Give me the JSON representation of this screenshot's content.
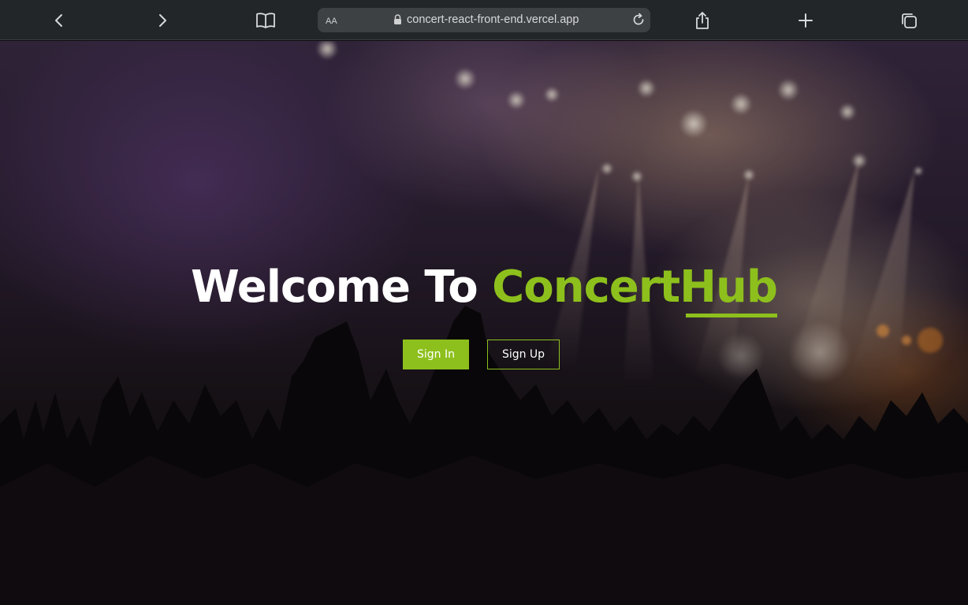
{
  "browser": {
    "reader_label": "AA",
    "url": "concert-react-front-end.vercel.app",
    "icons": [
      "chevron-left-icon",
      "chevron-right-icon",
      "book-icon",
      "lock-icon",
      "reload-icon",
      "share-icon",
      "plus-icon",
      "tabs-icon"
    ]
  },
  "hero": {
    "title_prefix": "Welcome To ",
    "brand_part1": "Concert",
    "brand_part2": "Hub",
    "signin_label": "Sign In",
    "signup_label": "Sign Up"
  },
  "colors": {
    "accent": "#8dc01c",
    "toolbar_bg": "#232629",
    "address_bar_bg": "#3e4144"
  }
}
